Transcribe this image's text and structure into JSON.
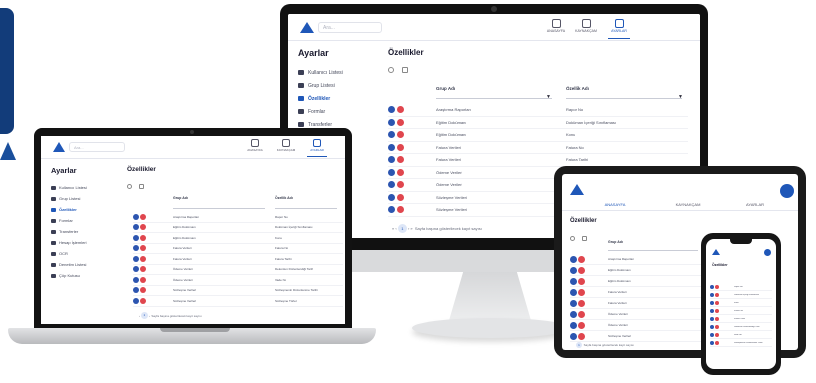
{
  "app": {
    "search_placeholder": "Ara...",
    "nav_tabs": [
      {
        "label": "ANASAYFA",
        "icon": "home-icon"
      },
      {
        "label": "KAYNAKÇAM",
        "icon": "document-icon"
      },
      {
        "label": "AYARLAR",
        "icon": "settings-icon",
        "active": true
      }
    ],
    "sidebar_title": "Ayarlar",
    "sidebar_items": [
      {
        "label": "Kullanıcı Listesi",
        "icon": "users-icon"
      },
      {
        "label": "Grup Listesi",
        "icon": "group-icon"
      },
      {
        "label": "Özellikler",
        "icon": "star-icon",
        "active": true
      },
      {
        "label": "Formlar",
        "icon": "form-icon"
      },
      {
        "label": "Transferler",
        "icon": "share-icon"
      },
      {
        "label": "Hesap İşlemleri",
        "icon": "account-icon"
      },
      {
        "label": "OCR",
        "icon": "scan-icon"
      },
      {
        "label": "Denetim Listesi",
        "icon": "list-icon"
      },
      {
        "label": "Çöp Kutusu",
        "icon": "trash-icon"
      }
    ],
    "page_title": "Özellikler",
    "columns": [
      "Grup Adı",
      "Özellik Adı"
    ],
    "rows": [
      {
        "group": "Araştırma Raporları",
        "feature": "Rapor No"
      },
      {
        "group": "Eğitim Dokümanı",
        "feature": "Doküman İçeriği Sınıflaması"
      },
      {
        "group": "Eğitim Dokümanı",
        "feature": "Konu"
      },
      {
        "group": "Fatura Verileri",
        "feature": "Fatura No"
      },
      {
        "group": "Fatura Verileri",
        "feature": "Fatura Tarihi"
      },
      {
        "group": "Ödeme Verileri",
        "feature": "Dekontun Düzenlendiği Tarih"
      },
      {
        "group": "Ödeme Verileri",
        "feature": "Vade No"
      },
      {
        "group": "Sözleşme Verileri",
        "feature": "Sözleşmenin Düzenlenme Tarihi"
      },
      {
        "group": "Sözleşme Verileri",
        "feature": "Sözleşme Türleri"
      }
    ],
    "pagination": {
      "current": "1",
      "summary": "Sayfa başına gösterilecek kayıt sayısı"
    },
    "tablet_tabs": [
      "ANASAYFA",
      "KAYNAKÇAM",
      "AYARLAR"
    ]
  },
  "colors": {
    "brand": "#1f57b8",
    "danger": "#e0464e",
    "dark_brand": "#123c7a"
  }
}
